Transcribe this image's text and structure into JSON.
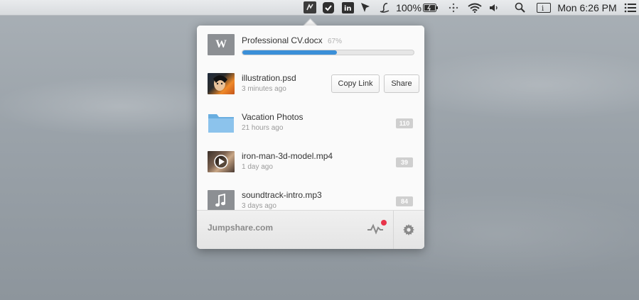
{
  "menubar": {
    "battery_percent": "100%",
    "clock": "Mon 6:26 PM",
    "icons": [
      "jumpshare-icon",
      "todo-check-icon",
      "linkedin-icon",
      "cursor-icon",
      "script-l-icon",
      "battery-icon",
      "dots-icon",
      "wifi-icon",
      "volume-icon",
      "spotlight-icon",
      "input-menu-icon",
      "list-icon"
    ]
  },
  "popover": {
    "upload": {
      "badge": "W",
      "name": "Professional CV.docx",
      "percent_label": "67%",
      "progress": 0.55,
      "color": "#3a8fd8"
    },
    "files": [
      {
        "name": "illustration.psd",
        "meta": "3 minutes ago",
        "kind": "image"
      },
      {
        "name": "Vacation Photos",
        "meta": "21 hours ago",
        "kind": "folder",
        "count": "110"
      },
      {
        "name": "iron-man-3d-model.mp4",
        "meta": "1 day ago",
        "kind": "video",
        "count": "39"
      },
      {
        "name": "soundtrack-intro.mp3",
        "meta": "3 days ago",
        "kind": "audio",
        "count": "84"
      }
    ],
    "actions": {
      "copy_link": "Copy Link",
      "share": "Share"
    },
    "footer": {
      "site": "Jumpshare.com",
      "notification_color": "#e8344a"
    }
  }
}
